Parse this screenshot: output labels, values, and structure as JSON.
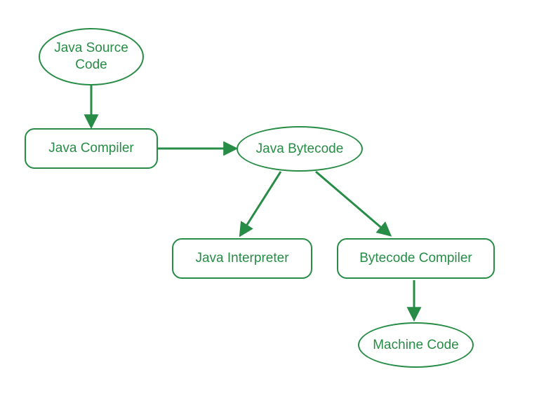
{
  "nodes": {
    "source": {
      "label": "Java Source\nCode"
    },
    "compiler": {
      "label": "Java Compiler"
    },
    "bytecode": {
      "label": "Java Bytecode"
    },
    "interp": {
      "label": "Java Interpreter"
    },
    "bcomp": {
      "label": "Bytecode Compiler"
    },
    "machine": {
      "label": "Machine Code"
    }
  },
  "flow": [
    [
      "source",
      "compiler"
    ],
    [
      "compiler",
      "bytecode"
    ],
    [
      "bytecode",
      "interp"
    ],
    [
      "bytecode",
      "bcomp"
    ],
    [
      "bcomp",
      "machine"
    ]
  ],
  "color": "#278c46"
}
